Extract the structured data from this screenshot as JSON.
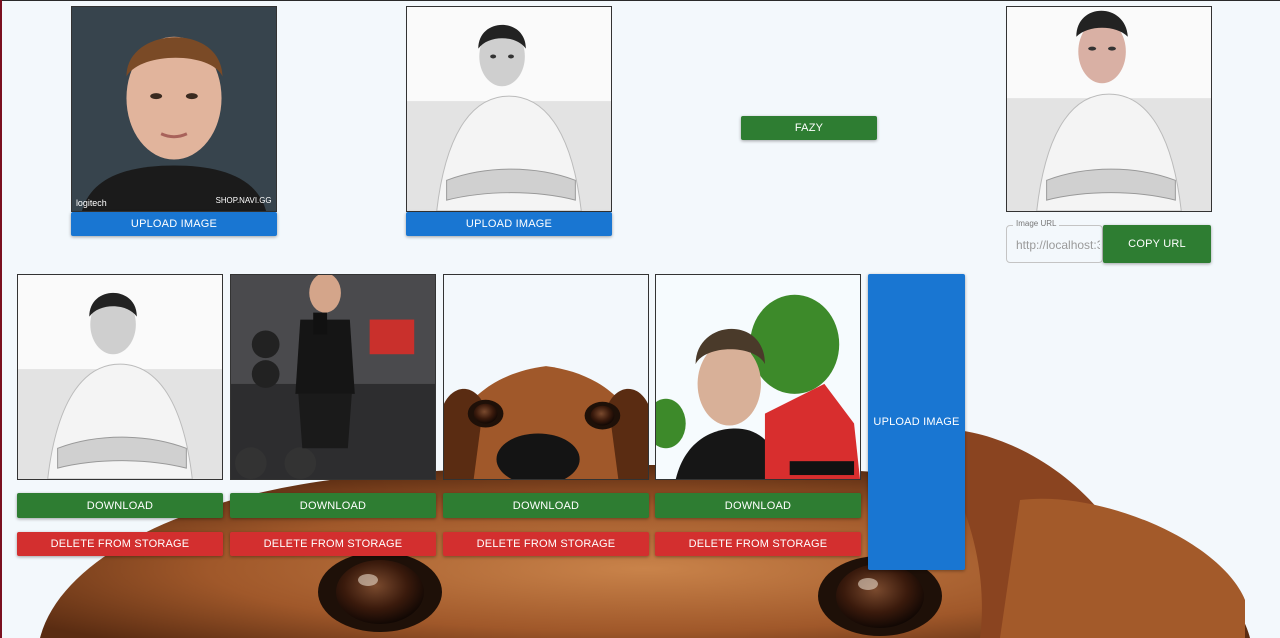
{
  "top": {
    "upload_button_1": "UPLOAD IMAGE",
    "upload_button_2": "UPLOAD IMAGE",
    "fazy_button": "FAZY",
    "image_url": {
      "label": "Image URL",
      "value": "http://localhost:3"
    },
    "copy_url_button": "COPY URL"
  },
  "gallery": {
    "items": [
      {
        "download_label": "DOWNLOAD",
        "delete_label": "DELETE FROM STORAGE"
      },
      {
        "download_label": "DOWNLOAD",
        "delete_label": "DELETE FROM STORAGE"
      },
      {
        "download_label": "DOWNLOAD",
        "delete_label": "DELETE FROM STORAGE"
      },
      {
        "download_label": "DOWNLOAD",
        "delete_label": "DELETE FROM STORAGE"
      }
    ],
    "upload_button": "UPLOAD IMAGE"
  },
  "colors": {
    "primary": "#1976d2",
    "success": "#2e7d32",
    "danger": "#d32f2f"
  }
}
